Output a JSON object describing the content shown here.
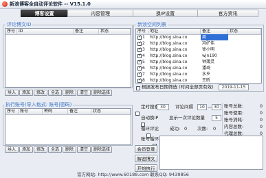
{
  "window": {
    "title": "新浪博客全自动评论软件 -- V15.1.0"
  },
  "tabs": [
    {
      "label": "博客设置",
      "active": true
    },
    {
      "label": "内容管理",
      "active": false
    },
    {
      "label": "换IP设置",
      "active": false
    },
    {
      "label": "官方资讯",
      "active": false
    }
  ],
  "comment_ids": {
    "title": "评论博文ID",
    "columns": [
      "序号",
      "ID",
      "备注",
      "状态"
    ],
    "rows": [],
    "buttons": [
      "导入",
      "添加",
      "修改",
      "全选",
      "删除",
      "清空",
      "删除选择"
    ]
  },
  "blog_list": {
    "title": "新浪空间列表",
    "columns": [
      "序号",
      "地址",
      "备注",
      "状态"
    ],
    "rows": [
      {
        "no": "1",
        "checked": true,
        "url": "http://blog.sina.co",
        "note": "周",
        "status": "",
        "selected": true
      },
      {
        "no": "2",
        "checked": true,
        "url": "http://blog.sina.co",
        "note": "冯矿伟",
        "status": "",
        "selected": false
      },
      {
        "no": "3",
        "checked": true,
        "url": "http://blog.sina.co",
        "note": "徐小明",
        "status": "",
        "selected": false
      },
      {
        "no": "4",
        "checked": true,
        "url": "http://blog.sina.co",
        "note": "wjn190",
        "status": "",
        "selected": false
      },
      {
        "no": "5",
        "checked": true,
        "url": "http://blog.sina.co",
        "note": "钟薄灵",
        "status": "",
        "selected": false
      },
      {
        "no": "6",
        "checked": true,
        "url": "http://blog.sina.co",
        "note": "潘琦",
        "status": "",
        "selected": false
      },
      {
        "no": "7",
        "checked": true,
        "url": "http://blog.sina.co",
        "note": "水乡",
        "status": "",
        "selected": false
      },
      {
        "no": "8",
        "checked": true,
        "url": "http://blog.sina.co",
        "note": "王昕",
        "status": "",
        "selected": false
      }
    ]
  },
  "date_filter": {
    "label": "根据发布日期筛选 (时间全部页有效)",
    "checked": false,
    "date": "2019-11-15"
  },
  "accounts": {
    "title": "执行账号(导入格式: 账号|密码)",
    "columns": [
      "序号",
      "账号",
      "密码",
      "备注",
      "状态"
    ],
    "rows": [],
    "buttons": [
      "导入",
      "添加",
      "修改",
      "全选",
      "删除",
      "清空",
      "删除选择"
    ]
  },
  "options": {
    "timed_search": {
      "label": "定时搜索",
      "checked": false,
      "value": "30"
    },
    "interval": {
      "label": "评论间隔",
      "min": "10",
      "sep": "—",
      "max": "30"
    },
    "auto_ip": {
      "label": "自动换IP",
      "checked": false
    },
    "per_batch": {
      "label": "显示一次评论数量",
      "value": "5"
    },
    "loop_comment": {
      "label": "循环评论",
      "checked": false
    },
    "success": {
      "label": "成功:",
      "value": "0"
    },
    "count": {
      "label": "次数:",
      "value": "0"
    },
    "loop_account": {
      "label": "账号循环",
      "checked": false
    }
  },
  "stats": [
    {
      "label": "账号总数:",
      "value": "0"
    },
    {
      "label": "账号使用:",
      "value": "0"
    },
    {
      "label": "账号消耗:",
      "value": "0"
    },
    {
      "label": "内容总数:",
      "value": "0"
    },
    {
      "label": "代理总数:",
      "value": "0"
    }
  ],
  "actions": {
    "login": "会员登录",
    "decrypt": "解密博文",
    "start": "开始执行"
  },
  "log": {
    "text": ""
  },
  "footer": {
    "text": "官方网站: http://www.60188.com  联系QQ: 9439856"
  },
  "colors": {
    "accent": "#3d72c9",
    "selected_row": "#2f6fd6",
    "active_tab": "#2b2b2b"
  }
}
